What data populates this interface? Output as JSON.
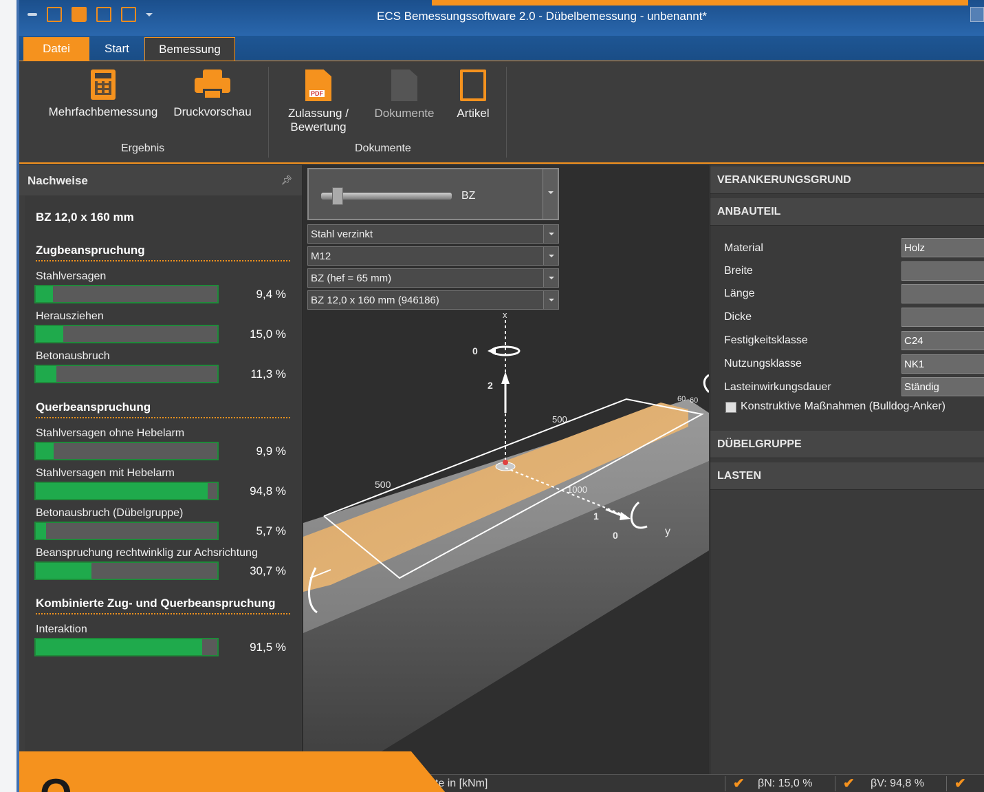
{
  "window": {
    "title": "ECS Bemessungssoftware 2.0 - Dübelbemessung - unbenannt*"
  },
  "tabs": [
    {
      "label": "Datei"
    },
    {
      "label": "Start"
    },
    {
      "label": "Bemessung"
    }
  ],
  "ribbon": {
    "buttons": {
      "mehrfach": "Mehrfachbemessung",
      "druck": "Druckvorschau",
      "zulassung": "Zulassung / Bewertung",
      "dokumente": "Dokumente",
      "artikel": "Artikel"
    },
    "groups": {
      "ergebnis": "Ergebnis",
      "dokumente": "Dokumente"
    }
  },
  "nachweise": {
    "header": "Nachweise",
    "anchor": "BZ 12,0 x 160 mm",
    "zug": {
      "title": "Zugbeanspruchung",
      "items": [
        {
          "label": "Stahlversagen",
          "value": "9,4 %",
          "fraction": 0.094
        },
        {
          "label": "Herausziehen",
          "value": "15,0 %",
          "fraction": 0.15
        },
        {
          "label": "Betonausbruch",
          "value": "11,3 %",
          "fraction": 0.113
        }
      ]
    },
    "quer": {
      "title": "Querbeanspruchung",
      "items": [
        {
          "label": "Stahlversagen ohne Hebelarm",
          "value": "9,9 %",
          "fraction": 0.099
        },
        {
          "label": "Stahlversagen mit Hebelarm",
          "value": "94,8 %",
          "fraction": 0.948
        },
        {
          "label": "Betonausbruch (Dübelgruppe)",
          "value": "5,7 %",
          "fraction": 0.057
        },
        {
          "label": "Beanspruchung rechtwinklig zur Achsrichtung",
          "value": "30,7 %",
          "fraction": 0.307
        }
      ]
    },
    "komb": {
      "title": "Kombinierte Zug- und Querbeanspruchung",
      "items": [
        {
          "label": "Interaktion",
          "value": "91,5 %",
          "fraction": 0.915
        }
      ]
    }
  },
  "viewer": {
    "anchor_type": "BZ",
    "selects": {
      "material": "Stahl verzinkt",
      "size": "M12",
      "depth": "BZ (hef = 65 mm)",
      "article": "BZ 12,0 x 160 mm (946186)"
    },
    "labels": {
      "x": "x",
      "y": "y",
      "zero_top": "0",
      "two": "2",
      "one": "1",
      "zero_bottom": "0",
      "d500a": "500",
      "d500b": "500",
      "d1000": "1000",
      "d60a": "60",
      "d60b": "60"
    }
  },
  "props": {
    "sections": {
      "verankerung": "VERANKERUNGSGRUND",
      "anbauteil": "ANBAUTEIL",
      "gruppe": "DÜBELGRUPPE",
      "lasten": "LASTEN"
    },
    "fields": [
      {
        "label": "Material",
        "value": "Holz"
      },
      {
        "label": "Breite",
        "value": ""
      },
      {
        "label": "Länge",
        "value": ""
      },
      {
        "label": "Dicke",
        "value": ""
      },
      {
        "label": "Festigkeitsklasse",
        "value": "C24"
      },
      {
        "label": "Nutzungsklasse",
        "value": "NK1"
      },
      {
        "label": "Lasteinwirkungsdauer",
        "value": "Ständig"
      }
    ],
    "checkbox_label": "Konstruktive Maßnahmen (Bulldog-Anker)"
  },
  "status": {
    "units": "nte in [kNm]",
    "beta_n": "βN: 15,0 %",
    "beta_v": "βV: 94,8 %"
  },
  "promo": {
    "text": "O"
  },
  "colors": {
    "accent": "#f5921e",
    "ok_green": "#1faa4c",
    "title_blue": "#1b4f8c"
  }
}
